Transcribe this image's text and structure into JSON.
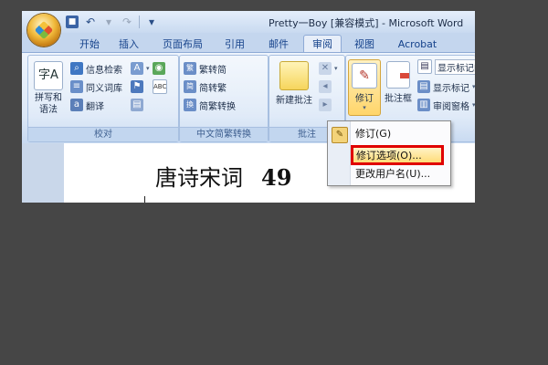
{
  "window": {
    "title": "Pretty一Boy [兼容模式] - Microsoft Word"
  },
  "quick_access": {
    "items": [
      "save-icon",
      "undo-icon",
      "redo-icon",
      "customize-icon"
    ]
  },
  "tabs": [
    {
      "label": "开始"
    },
    {
      "label": "插入"
    },
    {
      "label": "页面布局"
    },
    {
      "label": "引用"
    },
    {
      "label": "邮件"
    },
    {
      "label": "审阅",
      "active": true
    },
    {
      "label": "视图"
    },
    {
      "label": "Acrobat"
    }
  ],
  "ribbon": {
    "proofing": {
      "label": "校对",
      "spelling": "拼写和\n语法",
      "research": "信息检索",
      "thesaurus": "同义词库",
      "translate": "翻译"
    },
    "chinese_conv": {
      "label": "中文简繁转换",
      "to_traditional": "繁转简",
      "to_simplified": "简转繁",
      "convert": "简繁转换"
    },
    "comments": {
      "label": "批注",
      "new_comment": "新建批注"
    },
    "tracking": {
      "track_changes": "修订",
      "balloons": "批注框",
      "show_final": "显示标记的...",
      "show_markup": "显示标记",
      "reviewing_pane": "审阅窗格"
    }
  },
  "document": {
    "title": "唐诗宋词",
    "number": "49"
  },
  "menu": {
    "items": [
      {
        "label": "修订(G)"
      },
      {
        "label": "修订选项(O)...",
        "highlighted": true
      },
      {
        "label": "更改用户名(U)..."
      }
    ]
  },
  "colors": {
    "accent_highlight": "#e00000",
    "ribbon_blue": "#dce8f7",
    "backdrop": "#464646"
  }
}
